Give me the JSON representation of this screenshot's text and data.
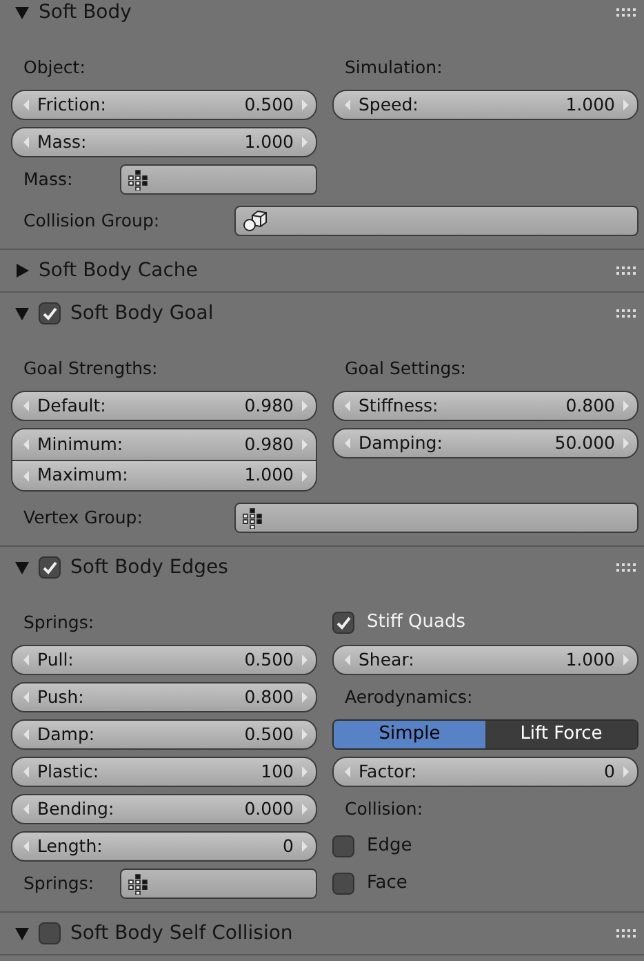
{
  "panels": [
    {
      "title": "Soft Body",
      "expanded": true,
      "columns": [
        [
          {
            "kind": "heading",
            "text": "Object:"
          },
          {
            "kind": "number",
            "label": "Friction:",
            "value": "0.500"
          },
          {
            "kind": "number",
            "label": "Mass:",
            "value": "1.000"
          },
          {
            "kind": "vertex_group_field",
            "label": "Mass:"
          }
        ],
        [
          {
            "kind": "heading",
            "text": "Simulation:"
          },
          {
            "kind": "number",
            "label": "Speed:",
            "value": "1.000"
          }
        ]
      ],
      "rows": [
        {
          "kind": "object_group_field",
          "label": "Collision Group:"
        }
      ]
    },
    {
      "title": "Soft Body Cache",
      "expanded": false
    },
    {
      "title": "Soft Body Goal",
      "expanded": true,
      "checked": true,
      "columns": [
        [
          {
            "kind": "heading",
            "text": "Goal Strengths:"
          },
          {
            "kind": "number",
            "label": "Default:",
            "value": "0.980"
          },
          {
            "kind": "number_group",
            "fields": [
              {
                "label": "Minimum:",
                "value": "0.980"
              },
              {
                "label": "Maximum:",
                "value": "1.000"
              }
            ]
          }
        ],
        [
          {
            "kind": "heading",
            "text": "Goal Settings:"
          },
          {
            "kind": "number",
            "label": "Stiffness:",
            "value": "0.800"
          },
          {
            "kind": "number",
            "label": "Damping:",
            "value": "50.000"
          }
        ]
      ],
      "rows": [
        {
          "kind": "vertex_group_field",
          "label": "Vertex Group:"
        }
      ]
    },
    {
      "title": "Soft Body Edges",
      "expanded": true,
      "checked": true,
      "columns": [
        [
          {
            "kind": "heading",
            "text": "Springs:"
          },
          {
            "kind": "number",
            "label": "Pull:",
            "value": "0.500"
          },
          {
            "kind": "number",
            "label": "Push:",
            "value": "0.800"
          },
          {
            "kind": "number",
            "label": "Damp:",
            "value": "0.500"
          },
          {
            "kind": "number",
            "label": "Plastic:",
            "value": "100"
          },
          {
            "kind": "number",
            "label": "Bending:",
            "value": "0.000"
          },
          {
            "kind": "number",
            "label": "Length:",
            "value": "0"
          },
          {
            "kind": "vertex_group_field",
            "label": "Springs:"
          }
        ],
        [
          {
            "kind": "checkbox",
            "label": "Stiff Quads",
            "checked": true
          },
          {
            "kind": "number",
            "label": "Shear:",
            "value": "1.000"
          },
          {
            "kind": "heading",
            "text": "Aerodynamics:"
          },
          {
            "kind": "toggle",
            "options": [
              {
                "label": "Simple",
                "selected": true
              },
              {
                "label": "Lift Force",
                "selected": false
              }
            ]
          },
          {
            "kind": "number",
            "label": "Factor:",
            "value": "0"
          },
          {
            "kind": "heading",
            "text": "Collision:"
          },
          {
            "kind": "checkbox",
            "label": "Edge",
            "checked": false
          },
          {
            "kind": "checkbox",
            "label": "Face",
            "checked": false
          }
        ]
      ]
    },
    {
      "title": "Soft Body Self Collision",
      "expanded": true,
      "checked": false
    }
  ]
}
